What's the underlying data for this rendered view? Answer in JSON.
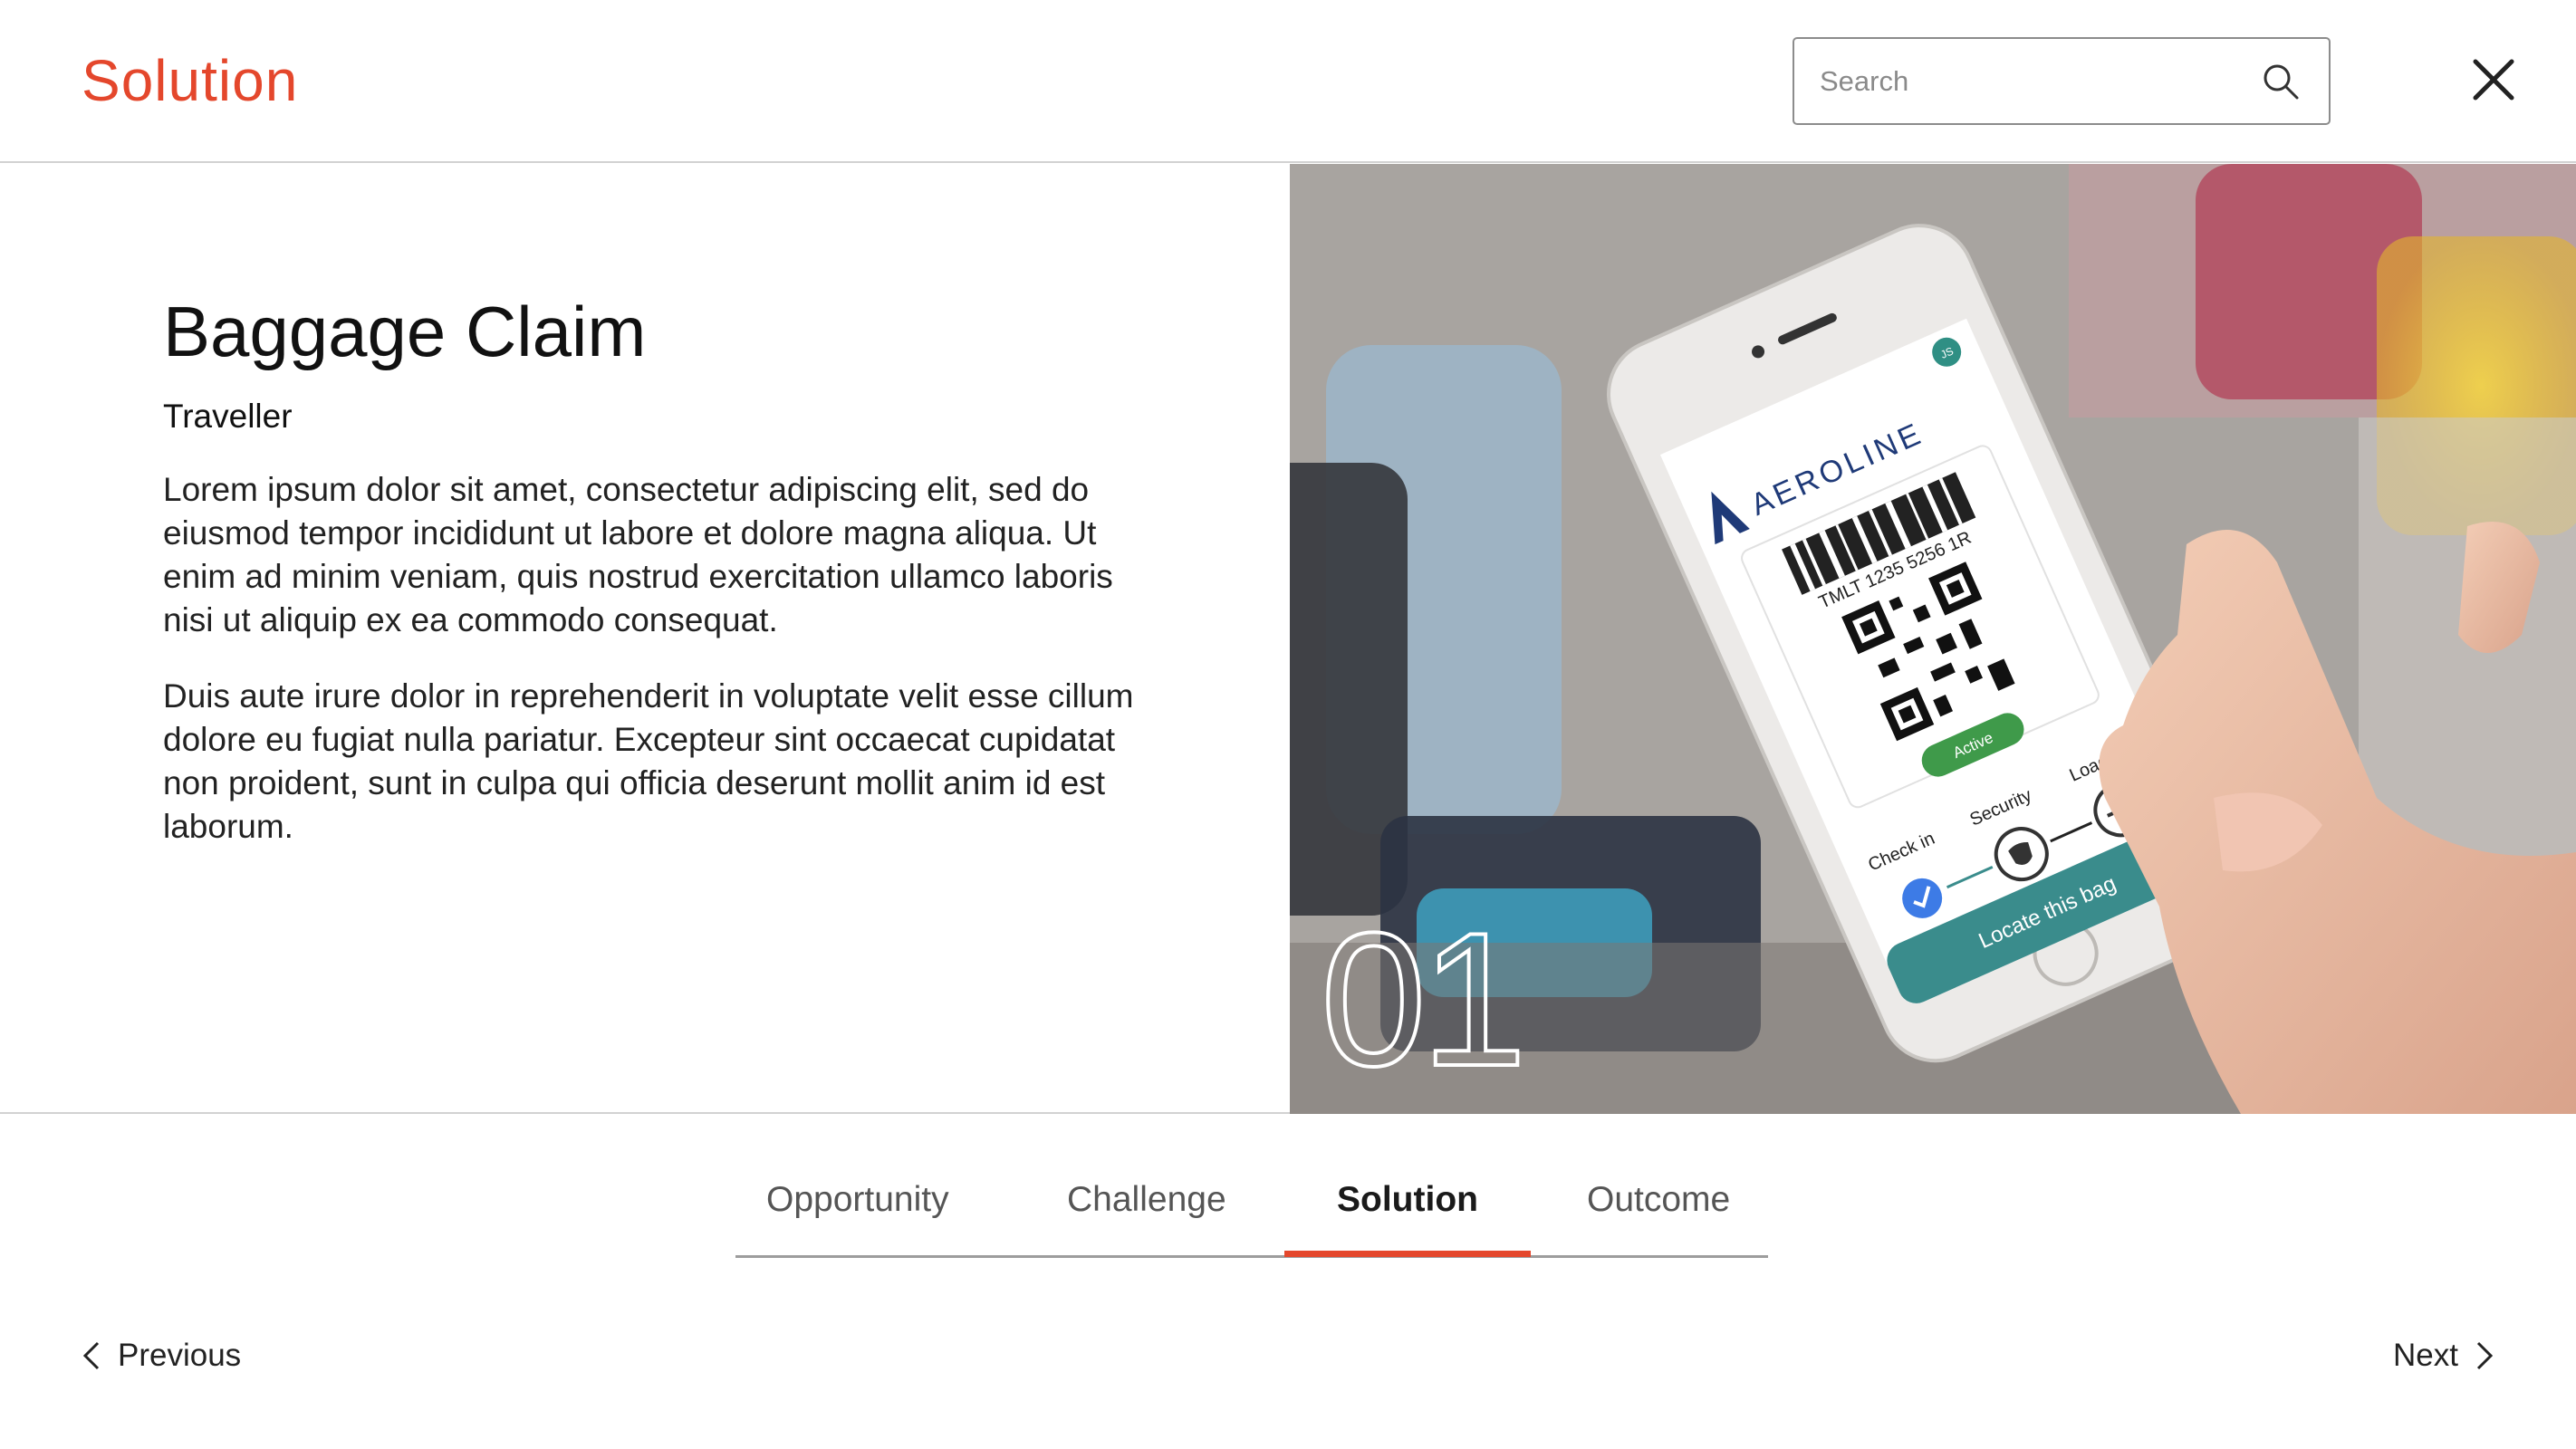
{
  "header": {
    "title": "Solution",
    "search_placeholder": "Search"
  },
  "story": {
    "title": "Baggage Claim",
    "subtitle": "Traveller",
    "paragraphs": [
      "Lorem ipsum dolor sit amet, consectetur adipiscing elit, sed do eiusmod tempor incididunt ut labore et dolore magna aliqua. Ut enim ad minim veniam, quis nostrud exercitation ullamco laboris nisi ut aliquip ex ea commodo consequat.",
      "Duis aute irure dolor in reprehenderit in voluptate velit esse cillum dolore eu fugiat nulla pariatur. Excepteur sint occaecat cupidatat non proident, sunt in culpa qui officia deserunt mollit anim id est laborum."
    ],
    "slide_number": "01"
  },
  "phone": {
    "brand": "AEROLINE",
    "avatar_initials": "JS",
    "barcode_text": "TMLT 1235 5256 1R",
    "status": "Active",
    "steps": [
      "Check in",
      "Security",
      "Loading"
    ],
    "cta": "Locate this bag"
  },
  "tabs": [
    {
      "label": "Opportunity"
    },
    {
      "label": "Challenge"
    },
    {
      "label": "Solution"
    },
    {
      "label": "Outcome"
    }
  ],
  "active_tab": "Solution",
  "pagination": {
    "previous": "Previous",
    "next": "Next"
  },
  "colors": {
    "accent": "#e4472c",
    "brand_navy": "#1f3a78",
    "teal": "#3a8c8c",
    "active_green": "#3f9a4a",
    "check_blue": "#3d7be6"
  }
}
